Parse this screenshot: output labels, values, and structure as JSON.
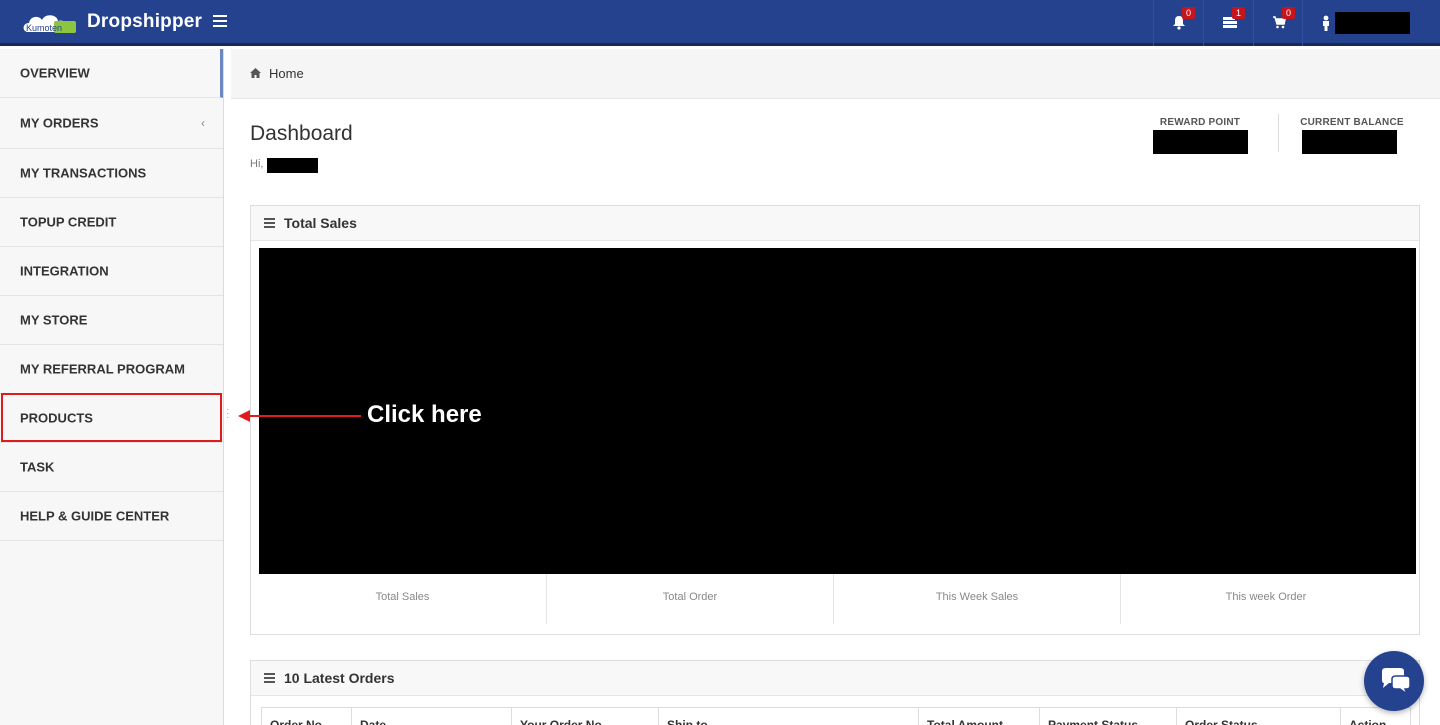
{
  "header": {
    "logo_text": "Kumoten",
    "brand": "Dropshipper",
    "notifications_count": "0",
    "messages_count": "1",
    "cart_count": "0",
    "colors": {
      "bar": "#25428f",
      "badge": "#c4161c"
    }
  },
  "sidebar": {
    "items": [
      {
        "label": "OVERVIEW"
      },
      {
        "label": "MY ORDERS",
        "chevron": "‹"
      },
      {
        "label": "MY TRANSACTIONS"
      },
      {
        "label": "TOPUP CREDIT"
      },
      {
        "label": "INTEGRATION"
      },
      {
        "label": "MY STORE"
      },
      {
        "label": "MY REFERRAL PROGRAM"
      },
      {
        "label": "PRODUCTS"
      },
      {
        "label": "TASK"
      },
      {
        "label": "HELP & GUIDE CENTER"
      }
    ]
  },
  "breadcrumb": {
    "home": "Home"
  },
  "dashboard": {
    "title": "Dashboard",
    "greeting": "Hi,",
    "reward_point_label": "REWARD POINT",
    "current_balance_label": "CURRENT BALANCE"
  },
  "total_sales_panel": {
    "title": "Total Sales",
    "summary": [
      "Total Sales",
      "Total Order",
      "This Week Sales",
      "This week Order"
    ]
  },
  "latest_orders_panel": {
    "title": "10 Latest Orders",
    "columns": [
      "Order No",
      "Date",
      "Your Order No",
      "Ship to",
      "Total Amount",
      "Payment Status",
      "Order Status",
      "Action"
    ]
  },
  "annotation": {
    "text": "Click here",
    "color": "#e11b1b"
  }
}
